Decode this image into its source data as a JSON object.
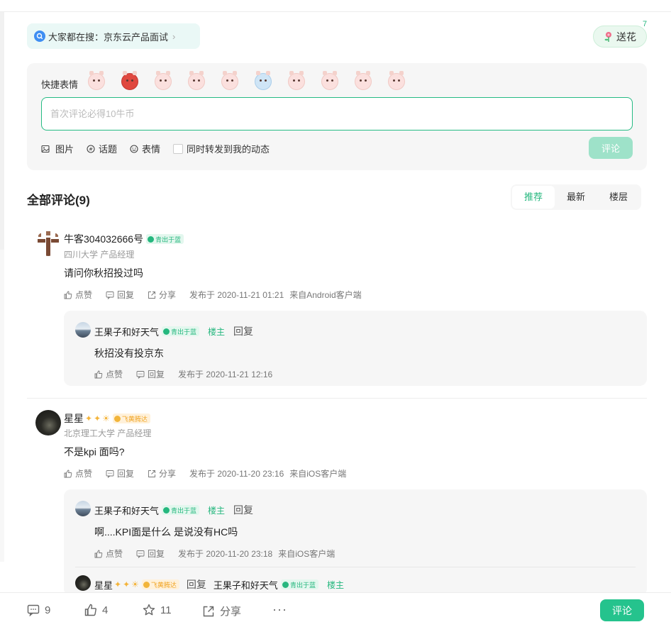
{
  "hot_search": {
    "prefix": "大家都在搜：",
    "keyword": "京东云产品面试",
    "chevron": "›"
  },
  "flower": {
    "label": "送花",
    "count": "7"
  },
  "composer": {
    "emoji_label": "快捷表情",
    "placeholder": "首次评论必得10牛币",
    "tools": {
      "image": "图片",
      "topic": "话题",
      "emoji": "表情"
    },
    "forward_label": "同时转发到我的动态",
    "submit_label": "评论"
  },
  "comments_header": {
    "title": "全部评论(9)"
  },
  "sort_tabs": [
    {
      "label": "推荐",
      "active": true
    },
    {
      "label": "最新"
    },
    {
      "label": "楼层"
    }
  ],
  "comments": [
    {
      "user": "牛客304032666号",
      "badge": "青出于蓝",
      "school": "四川大学 产品经理",
      "text": "请问你秋招投过吗",
      "like": "点赞",
      "reply": "回复",
      "share": "分享",
      "time": "发布于 2020-11-21 01:21",
      "source": "来自Android客户端",
      "replies": [
        {
          "user": "王果子和好天气",
          "badge": "青出于蓝",
          "owner": "楼主",
          "reply_word": "回复",
          "text": "秋招没有投京东",
          "like": "点赞",
          "reply": "回复",
          "time": "发布于 2020-11-21 12:16"
        }
      ]
    },
    {
      "user": "星星",
      "badge": "飞黄腾达",
      "school": "北京理工大学 产品经理",
      "text": "不是kpi 面吗?",
      "like": "点赞",
      "reply": "回复",
      "share": "分享",
      "time": "发布于 2020-11-20 23:16",
      "source": "来自iOS客户端",
      "replies": [
        {
          "user": "王果子和好天气",
          "badge": "青出于蓝",
          "owner": "楼主",
          "reply_word": "回复",
          "text": "啊....KPI面是什么 是说没有HC吗",
          "like": "点赞",
          "reply": "回复",
          "time": "发布于 2020-11-20 23:18",
          "source": "来自iOS客户端"
        },
        {
          "user": "星星",
          "badge": "飞黄腾达",
          "reply_word": "回复",
          "target_user": "王果子和好天气",
          "target_badge": "青出于蓝",
          "owner": "楼主"
        }
      ]
    }
  ],
  "bottom_bar": {
    "comments": "9",
    "likes": "4",
    "favorites": "11",
    "share": "分享",
    "more": "···",
    "comment_button": "评论"
  },
  "colors": {
    "accent": "#25b77e",
    "button_disabled": "#9ee2c9",
    "panel": "#f6f6f6"
  }
}
